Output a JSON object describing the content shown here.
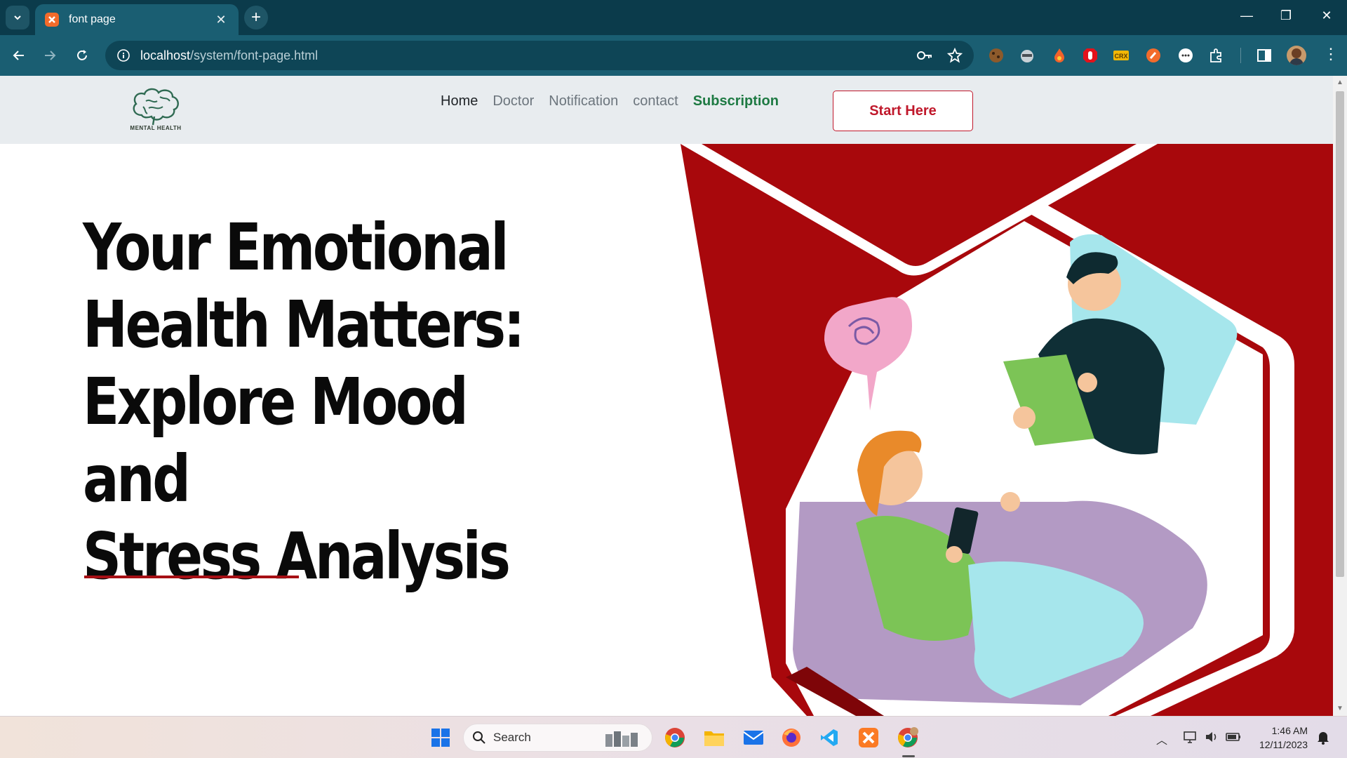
{
  "browser": {
    "tab_title": "font page",
    "url_host": "localhost",
    "url_path": "/system/font-page.html"
  },
  "site": {
    "logo_text": "MENTAL HEALTH",
    "nav": [
      {
        "label": "Home"
      },
      {
        "label": "Doctor"
      },
      {
        "label": "Notification"
      },
      {
        "label": "contact"
      },
      {
        "label": "Subscription"
      }
    ],
    "cta_label": "Start Here",
    "hero_lines": [
      "Your Emotional",
      "Health Matters:",
      "Explore Mood and",
      "Stress Analysis"
    ],
    "colors": {
      "accent": "#a60f14",
      "subscription": "#1e7a43",
      "nav_bg": "#e8ecef"
    }
  },
  "taskbar": {
    "search_placeholder": "Search",
    "time": "1:46 AM",
    "date": "12/11/2023",
    "apps": [
      "windows-start-icon",
      "chrome-icon",
      "file-explorer-icon",
      "mail-icon",
      "firefox-icon",
      "vscode-icon",
      "xampp-icon",
      "chrome-profile-icon"
    ]
  }
}
